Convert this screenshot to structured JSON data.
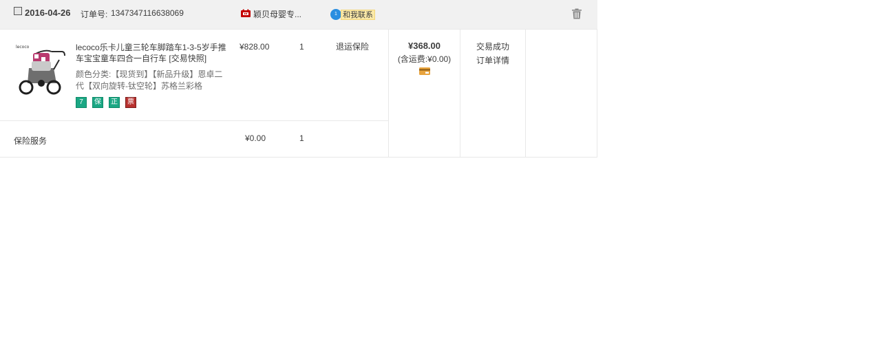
{
  "order": {
    "date": "2016-04-26",
    "order_no_label": "订单号:",
    "order_no": "1347347116638069",
    "shop_name": "颖贝母婴专...",
    "contact_label": "和我联系",
    "contact_badge": "1",
    "colors": {
      "header_bg": "#f1f1f1",
      "border": "#e8e8e8",
      "contact_bg": "#fbe9a8",
      "contact_bubble": "#2a8ee0"
    }
  },
  "product": {
    "title": "lecoco乐卡儿童三轮车脚踏车1-3-5岁手推车宝宝童车四合一自行车",
    "snapshot_label": "[交易快照]",
    "sku": "颜色分类:【现货到】【新品升级】恩卓二代【双向旋转-钛空轮】苏格兰彩格",
    "thumb_brand": "lecoco",
    "price": "¥828.00",
    "quantity": "1",
    "refund_link": "退运保险",
    "badges": [
      {
        "icon": "seven-day-return-icon",
        "glyph": "7",
        "color": "#1ba784"
      },
      {
        "icon": "consumer-protection-icon",
        "glyph": "保",
        "color": "#1ba784"
      },
      {
        "icon": "genuine-guarantee-icon",
        "glyph": "正",
        "color": "#1ba784"
      },
      {
        "icon": "invoice-icon",
        "glyph": "票",
        "color": "#b8312f"
      }
    ]
  },
  "insurance": {
    "label": "保险服务",
    "price": "¥0.00",
    "quantity": "1"
  },
  "summary": {
    "total": "¥368.00",
    "shipping": "(含运费:¥0.00)",
    "status": "交易成功",
    "detail_link": "订单详情"
  }
}
